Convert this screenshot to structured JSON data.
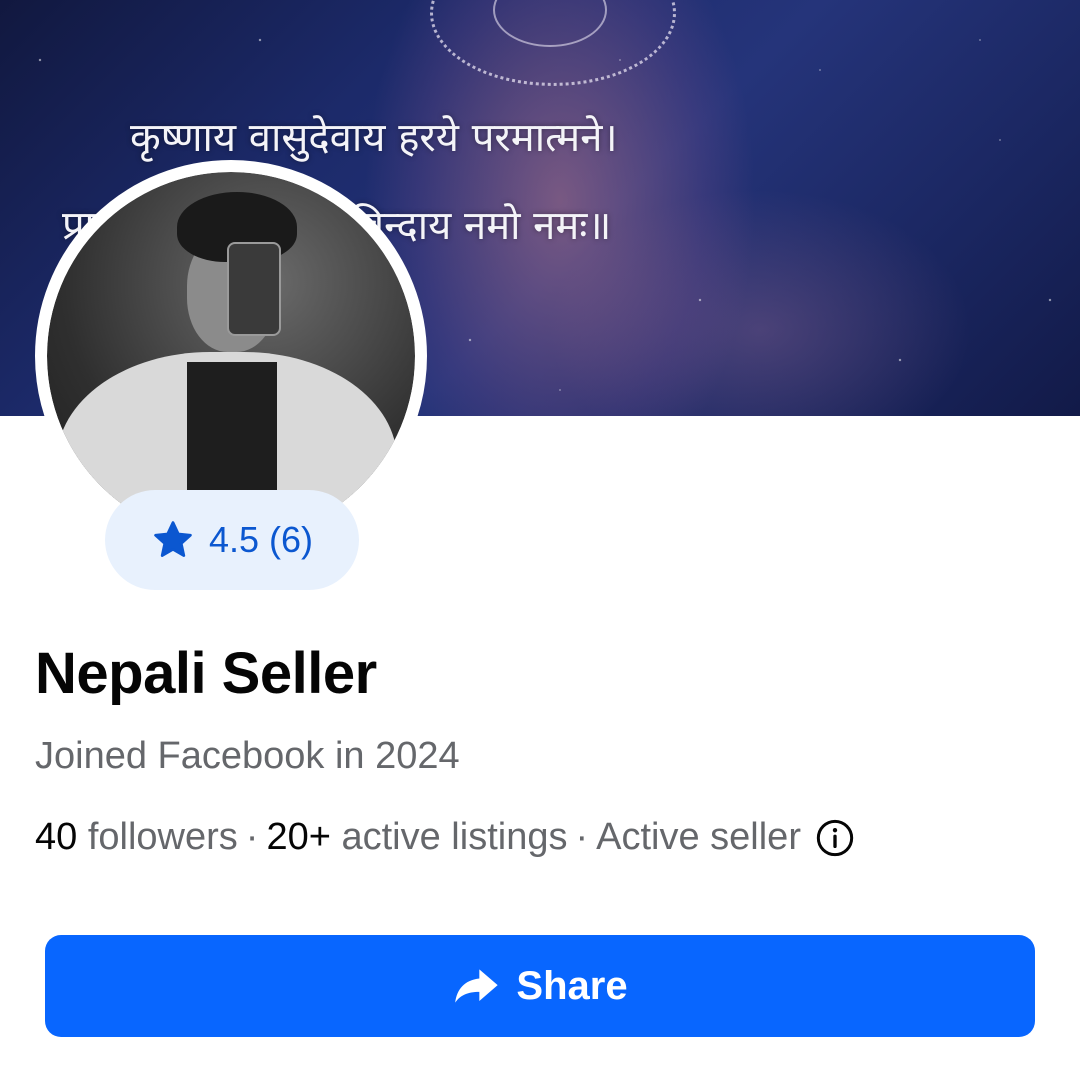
{
  "cover": {
    "line1": "कृष्णाय वासुदेवाय हरये परमात्मने।",
    "line2": "प्रणतक्लेशनाशाय गोविन्दाय नमो नमः॥"
  },
  "profile": {
    "rating": "4.5 (6)",
    "name": "Nepali Seller",
    "joined": "Joined Facebook in 2024",
    "followers_count": "40",
    "followers_label": "followers",
    "separator": "·",
    "listings_count": "20+",
    "listings_label": "active listings",
    "seller_status": "Active seller"
  },
  "share": {
    "label": "Share"
  },
  "colors": {
    "accent": "#0866ff",
    "rating_bg": "#e8f1fd",
    "rating_text": "#0b57d0",
    "secondary_text": "#65676b"
  },
  "icons": {
    "rating": "star-icon",
    "info": "info-icon",
    "share": "share-arrow-icon"
  }
}
